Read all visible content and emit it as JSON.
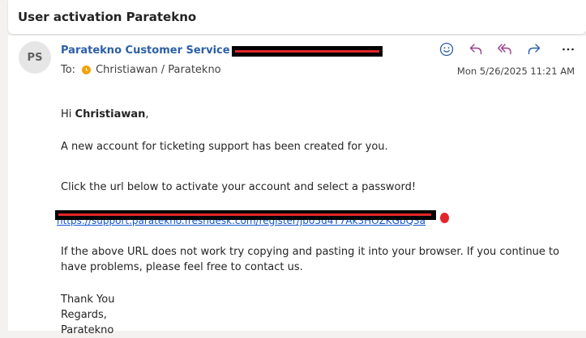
{
  "subject": "User activation Paratekno",
  "sender": {
    "initials": "PS",
    "name": "Paratekno Customer Service"
  },
  "recipient": {
    "label": "To:",
    "name": "Christiawan / Paratekno"
  },
  "date": "Mon 5/26/2025 11:21 AM",
  "actions": [
    "emoji-reaction-icon",
    "reply-icon",
    "reply-all-icon",
    "forward-icon",
    "more-icon"
  ],
  "body": {
    "greeting_prefix": "Hi ",
    "greeting_name": "Christiawan",
    "greeting_suffix": ",",
    "line1": "A new account for ticketing support has been created for you.",
    "line2": "Click the url below to activate your account and select a password!",
    "link_text": "https://support.paratekno.freshdesk.com/register/jb05d4T7Ak3HOZKGbQ3a",
    "line3": "If the above URL does not work try copying and pasting it into your browser. If you continue to have problems, please feel free to contact us.",
    "closing1": "Thank You",
    "closing2": "Regards,",
    "closing3": "Paratekno"
  },
  "colors": {
    "accent": "#2c5fa8",
    "link": "#1155cc",
    "redaction": "#000000",
    "redaction_mark": "#e3262a",
    "presence": "#f0a30a"
  }
}
